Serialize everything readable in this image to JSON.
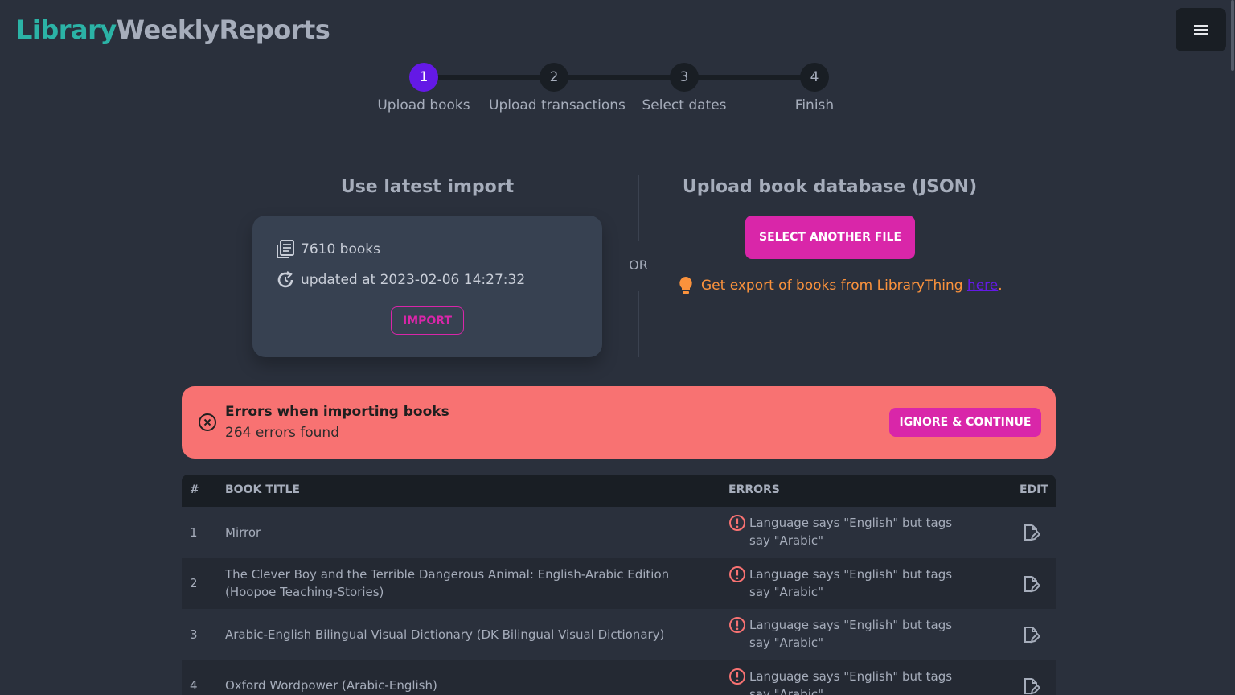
{
  "brand": {
    "part1": "Library",
    "part2": "WeeklyReports"
  },
  "stepper": {
    "steps": [
      {
        "number": "1",
        "label": "Upload books",
        "active": true
      },
      {
        "number": "2",
        "label": "Upload transactions",
        "active": false
      },
      {
        "number": "3",
        "label": "Select dates",
        "active": false
      },
      {
        "number": "4",
        "label": "Finish",
        "active": false
      }
    ]
  },
  "latest_import": {
    "title": "Use latest import",
    "books": "7610 books",
    "updated": "updated at 2023-02-06 14:27:32",
    "import_label": "IMPORT"
  },
  "or_label": "OR",
  "upload": {
    "title": "Upload book database (JSON)",
    "button_label": "SELECT ANOTHER FILE",
    "hint_text": "Get export of books from LibraryThing ",
    "hint_link": "here",
    "hint_end": "."
  },
  "alert": {
    "title": "Errors when importing books",
    "subtitle": "264 errors found",
    "button_label": "IGNORE & CONTINUE"
  },
  "table": {
    "headers": {
      "num": "#",
      "title": "BOOK TITLE",
      "errors": "ERRORS",
      "edit": "EDIT"
    },
    "rows": [
      {
        "num": "1",
        "title": "Mirror",
        "error": "Language says \"English\" but tags say \"Arabic\""
      },
      {
        "num": "2",
        "title": "The Clever Boy and the Terrible Dangerous Animal: English-Arabic Edition (Hoopoe Teaching-Stories)",
        "error": "Language says \"English\" but tags say \"Arabic\""
      },
      {
        "num": "3",
        "title": "Arabic-English Bilingual Visual Dictionary (DK Bilingual Visual Dictionary)",
        "error": "Language says \"English\" but tags say \"Arabic\""
      },
      {
        "num": "4",
        "title": "Oxford Wordpower (Arabic-English)",
        "error": "Language says \"English\" but tags say \"Arabic\""
      }
    ]
  },
  "colors": {
    "background": "#2a303c",
    "primary": "#6419e6",
    "secondary": "#d926a9",
    "accent": "#2bb3a6",
    "error": "#f87272",
    "warning": "#fb923c"
  },
  "icons": {
    "menu": "hamburger-menu-icon",
    "books": "books-icon",
    "updated": "history-icon",
    "hint": "lightbulb-icon",
    "alert": "circle-x-icon",
    "row_error": "circle-exclamation-icon",
    "edit": "file-edit-icon"
  }
}
